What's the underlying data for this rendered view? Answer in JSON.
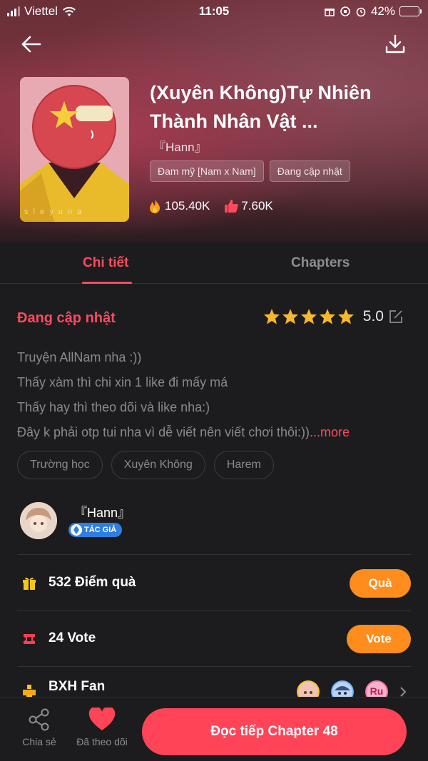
{
  "status_bar": {
    "carrier": "Viettel",
    "time": "11:05",
    "battery": "42%",
    "battery_level": 0.42
  },
  "header": {
    "title": "(Xuyên Không)Tự Nhiên Thành Nhân Vật ...",
    "author": "『Hann』",
    "tags": [
      "Đam mỹ [Nam x Nam]",
      "Đang cập nhật"
    ],
    "views": "105.40K",
    "likes": "7.60K",
    "cover_watermark": "s l e y u n a"
  },
  "tabs": [
    {
      "label": "Chi tiết",
      "active": true
    },
    {
      "label": "Chapters",
      "active": false
    }
  ],
  "details": {
    "status": "Đang cập nhật",
    "rating": 5.0,
    "rating_label": "5.0",
    "stars": 5,
    "description_lines": [
      "Truyện AllNam nha :))",
      "Thấy xàm thì chi xin 1 like đi mấy má",
      "Thấy hay thì theo dõi và like nha:)",
      "Đây k phải otp tui nha vì dễ viết nên viết chơi thôi:))"
    ],
    "more_label": "...more",
    "genres": [
      "Trường học",
      "Xuyên Không",
      "Harem"
    ]
  },
  "author": {
    "name": "『Hann』",
    "badge": "TÁC GIẢ"
  },
  "gift_row": {
    "label": "532 Điểm quà",
    "button": "Quà"
  },
  "vote_row": {
    "label": "24 Vote",
    "button": "Vote"
  },
  "fan_row": {
    "label": "BXH Fan",
    "fan_avatar_text": "Ru"
  },
  "bottom_bar": {
    "share_label": "Chia sẻ",
    "follow_label": "Đã theo dõi",
    "read_button": "Đọc tiếp Chapter 48"
  },
  "colors": {
    "accent": "#ff4a5e",
    "orange_button": "#ff8d1e",
    "star": "#f5b82e",
    "background": "#1c1c1e"
  }
}
